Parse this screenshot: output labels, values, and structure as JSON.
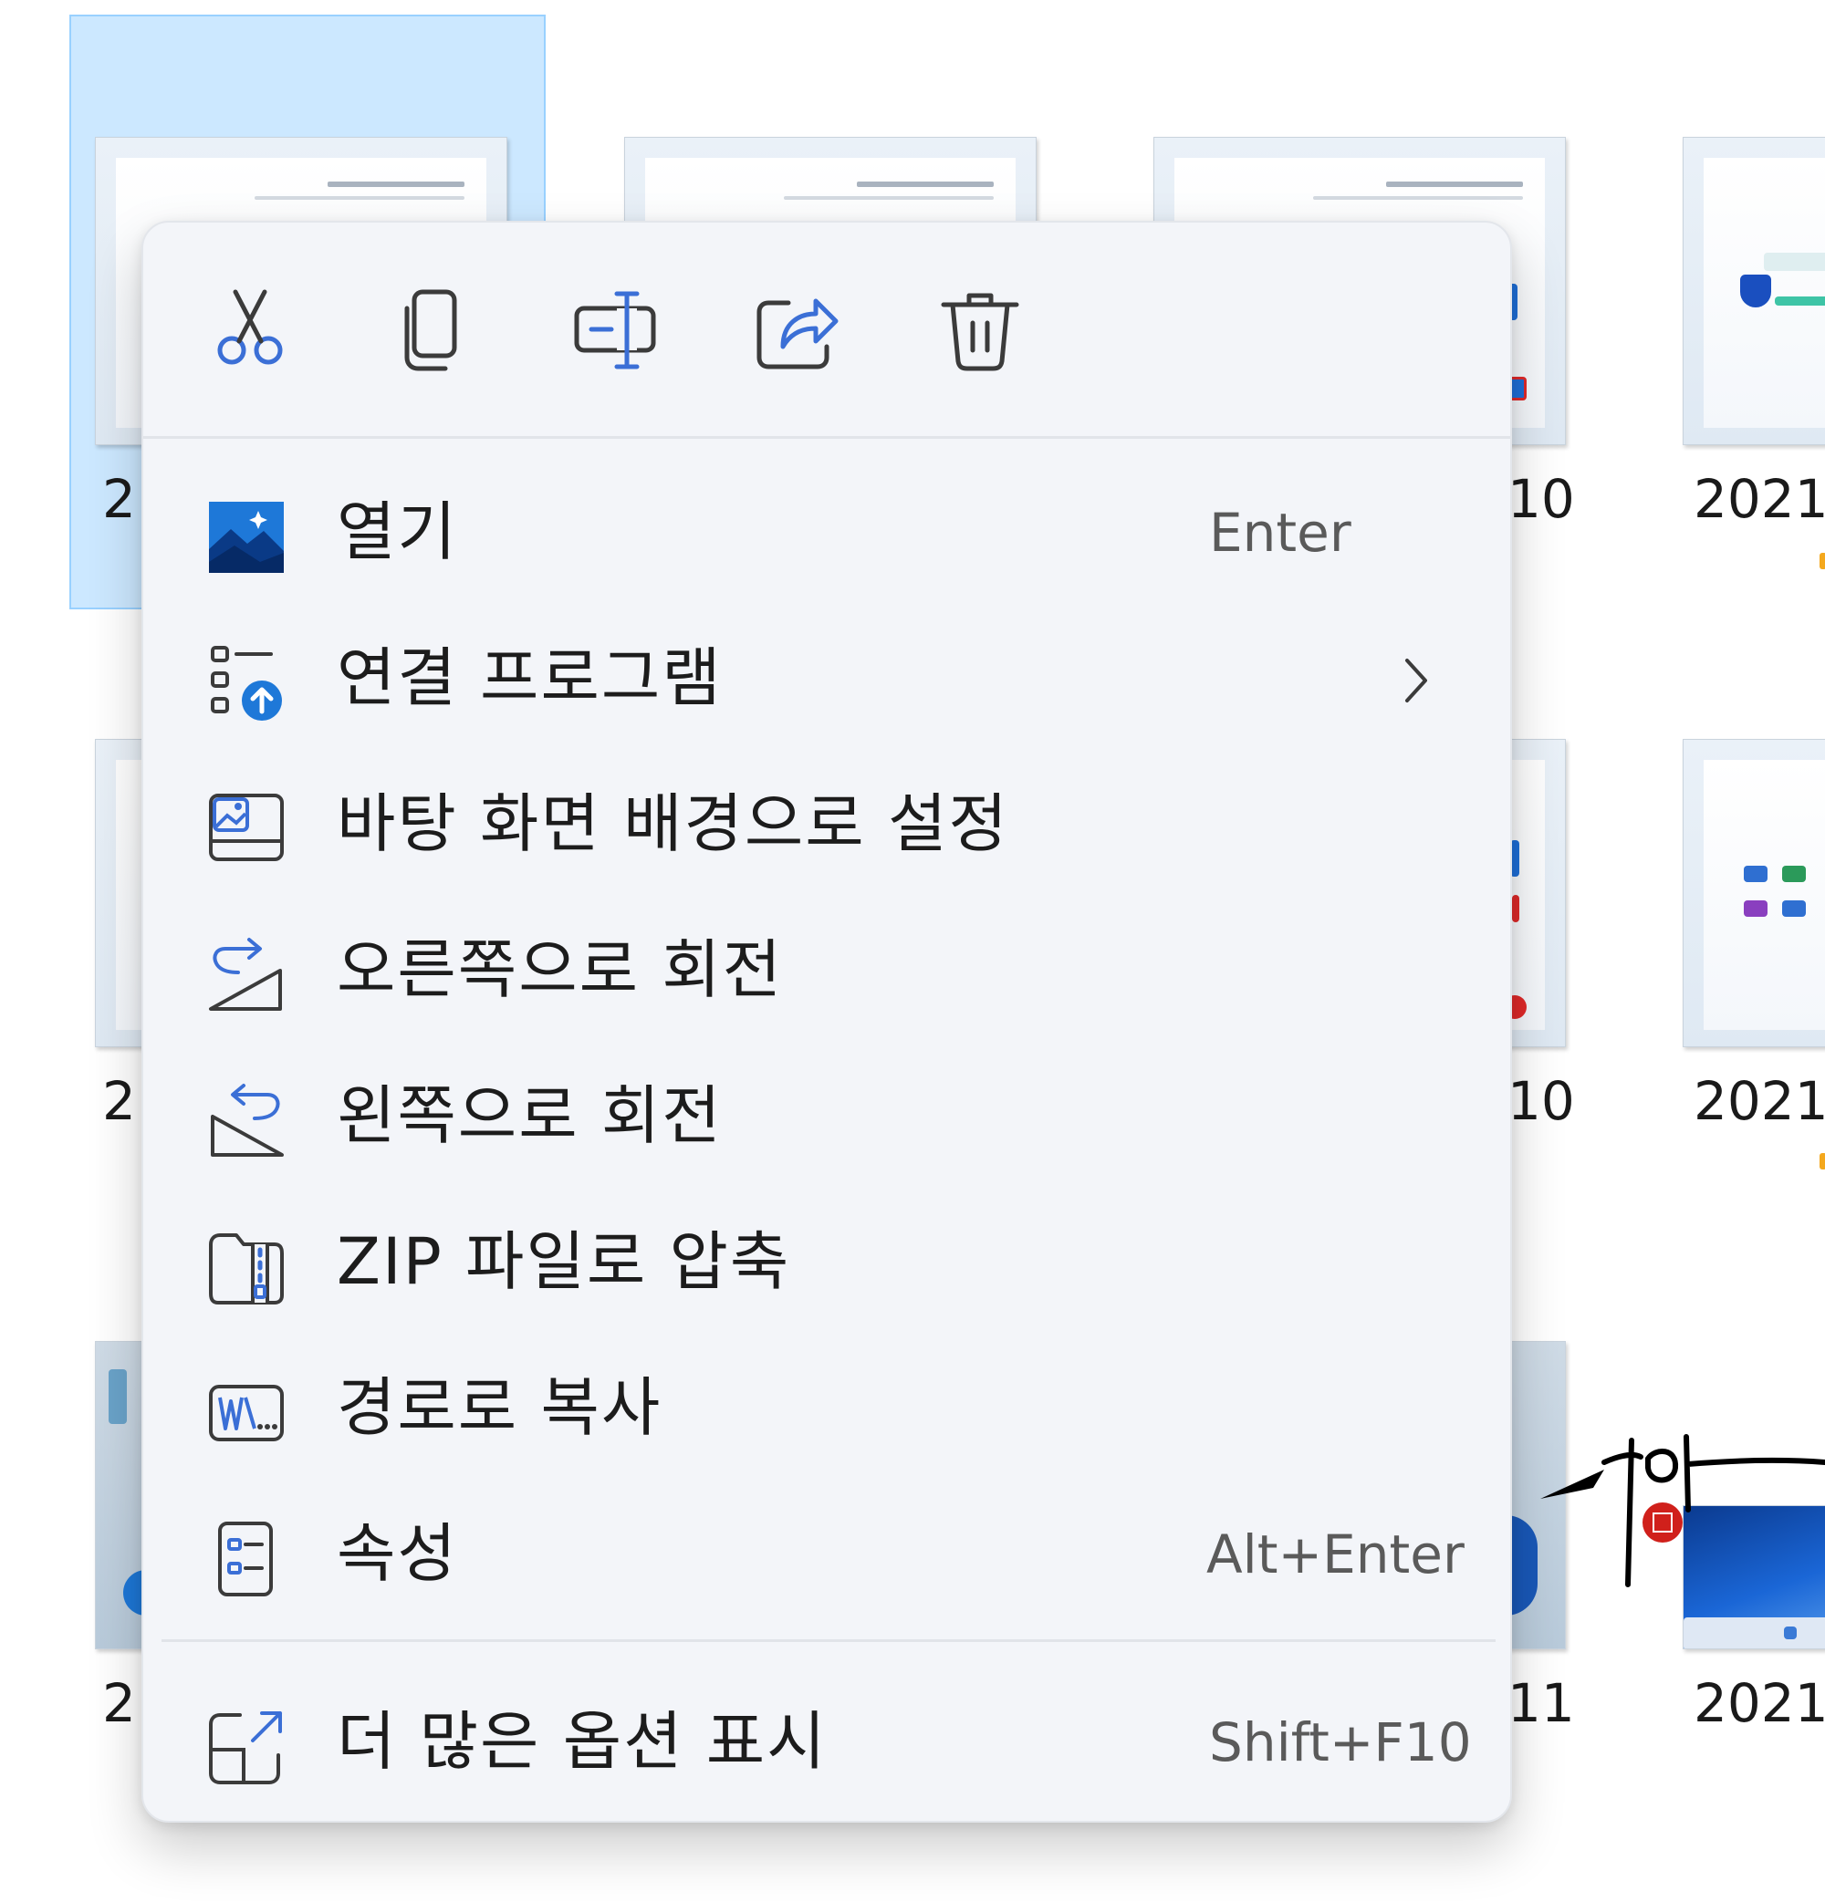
{
  "files": {
    "captions": [
      "2",
      "10",
      "2021",
      "2",
      "10",
      "2021",
      "2",
      "11",
      "2021"
    ]
  },
  "toolbar": {
    "cut_icon": "scissors-icon",
    "copy_icon": "copy-icon",
    "rename_icon": "rename-icon",
    "share_icon": "share-icon",
    "delete_icon": "trash-icon"
  },
  "menu": {
    "items": [
      {
        "label": "열기",
        "shortcut": "Enter",
        "icon": "photo-app-icon"
      },
      {
        "label": "연결 프로그램",
        "shortcut": "",
        "icon": "open-with-icon",
        "has_submenu": true
      },
      {
        "label": "바탕 화면 배경으로 설정",
        "shortcut": "",
        "icon": "wallpaper-icon"
      },
      {
        "label": "오른쪽으로 회전",
        "shortcut": "",
        "icon": "rotate-right-icon"
      },
      {
        "label": "왼쪽으로 회전",
        "shortcut": "",
        "icon": "rotate-left-icon"
      },
      {
        "label": "ZIP 파일로 압축",
        "shortcut": "",
        "icon": "zip-folder-icon"
      },
      {
        "label": "경로로 복사",
        "shortcut": "",
        "icon": "copy-path-icon"
      },
      {
        "label": "속성",
        "shortcut": "Alt+Enter",
        "icon": "properties-icon"
      }
    ],
    "more_options": {
      "label": "더 많은 옵션 표시",
      "shortcut": "Shift+F10",
      "icon": "more-options-icon"
    }
  },
  "watermark": {
    "text": "시아"
  },
  "colors": {
    "selection_fill": "#cce8ff",
    "selection_border": "#99d1ff",
    "menu_bg": "#f3f5f9",
    "icon_stroke": "#3b3b3b",
    "accent_blue": "#0b5fc2"
  }
}
